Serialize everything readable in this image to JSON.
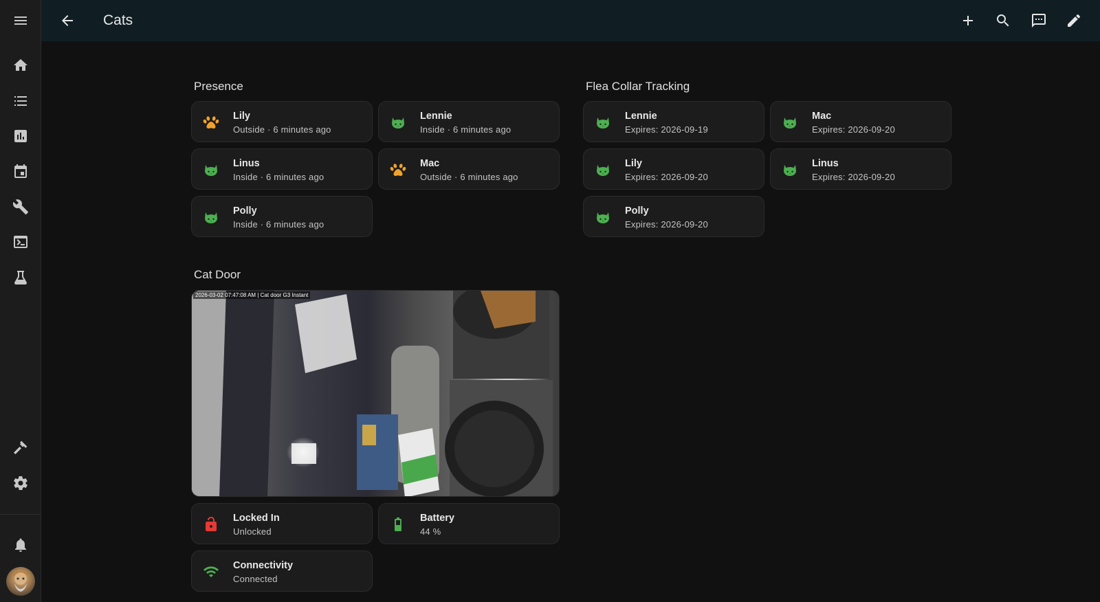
{
  "app": {
    "title": "Cats"
  },
  "sidebar": {
    "items": [
      {
        "icon": "menu-icon"
      },
      {
        "icon": "home-icon"
      },
      {
        "icon": "list-icon"
      },
      {
        "icon": "chart-icon"
      },
      {
        "icon": "calendar-icon"
      },
      {
        "icon": "wrench-icon"
      },
      {
        "icon": "terminal-icon"
      },
      {
        "icon": "flask-icon"
      },
      {
        "icon": "hammer-icon"
      },
      {
        "icon": "gear-icon"
      },
      {
        "icon": "bell-icon"
      }
    ]
  },
  "header": {
    "actions": [
      "add-icon",
      "search-icon",
      "assist-icon",
      "edit-icon"
    ]
  },
  "sections": {
    "presence": {
      "title": "Presence",
      "tiles": [
        {
          "name": "Lily",
          "state": "Outside · 6 minutes ago",
          "icon": "paw-icon",
          "color": "#f2a22c"
        },
        {
          "name": "Lennie",
          "state": "Inside · 6 minutes ago",
          "icon": "cat-icon",
          "color": "#4caf50"
        },
        {
          "name": "Linus",
          "state": "Inside · 6 minutes ago",
          "icon": "cat-icon",
          "color": "#4caf50"
        },
        {
          "name": "Mac",
          "state": "Outside · 6 minutes ago",
          "icon": "paw-icon",
          "color": "#f2a22c"
        },
        {
          "name": "Polly",
          "state": "Inside · 6 minutes ago",
          "icon": "cat-icon",
          "color": "#4caf50"
        }
      ]
    },
    "flea": {
      "title": "Flea Collar Tracking",
      "tiles": [
        {
          "name": "Lennie",
          "state": "Expires: 2026-09-19",
          "icon": "cat-icon",
          "color": "#4caf50"
        },
        {
          "name": "Mac",
          "state": "Expires: 2026-09-20",
          "icon": "cat-icon",
          "color": "#4caf50"
        },
        {
          "name": "Lily",
          "state": "Expires: 2026-09-20",
          "icon": "cat-icon",
          "color": "#4caf50"
        },
        {
          "name": "Linus",
          "state": "Expires: 2026-09-20",
          "icon": "cat-icon",
          "color": "#4caf50"
        },
        {
          "name": "Polly",
          "state": "Expires: 2026-09-20",
          "icon": "cat-icon",
          "color": "#4caf50"
        }
      ]
    },
    "catdoor": {
      "title": "Cat Door",
      "camera_stamp": "2026-03-02 07:47:08 AM | Cat door G3 Instant",
      "tiles": [
        {
          "name": "Locked In",
          "state": "Unlocked",
          "icon": "lock-open-icon",
          "color": "#e53935"
        },
        {
          "name": "Battery",
          "state": "44 %",
          "icon": "battery-icon",
          "color": "#4caf50"
        },
        {
          "name": "Connectivity",
          "state": "Connected",
          "icon": "wifi-icon",
          "color": "#4caf50"
        }
      ]
    }
  }
}
